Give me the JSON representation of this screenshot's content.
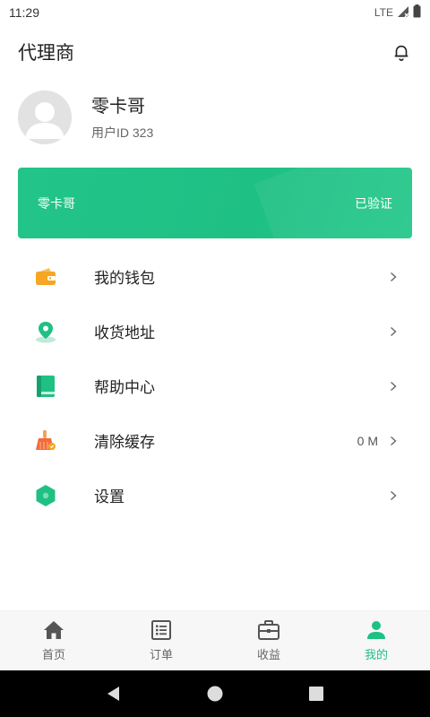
{
  "status_bar": {
    "time": "11:29",
    "network": "LTE"
  },
  "header": {
    "title": "代理商",
    "bell_icon": "bell-icon"
  },
  "profile": {
    "name": "零卡哥",
    "user_id": "用户ID 323",
    "avatar_icon": "user-avatar-placeholder"
  },
  "card": {
    "name": "零卡哥",
    "status": "已验证",
    "color": "#1fc084"
  },
  "menu": {
    "items": [
      {
        "label": "我的钱包",
        "icon": "wallet-icon",
        "value": ""
      },
      {
        "label": "收货地址",
        "icon": "location-pin-icon",
        "value": ""
      },
      {
        "label": "帮助中心",
        "icon": "book-icon",
        "value": ""
      },
      {
        "label": "清除缓存",
        "icon": "broom-icon",
        "value": "0 M"
      },
      {
        "label": "设置",
        "icon": "settings-hexagon-icon",
        "value": ""
      }
    ]
  },
  "bottom_nav": {
    "items": [
      {
        "label": "首页",
        "icon": "home-icon",
        "active": false
      },
      {
        "label": "订单",
        "icon": "list-icon",
        "active": false
      },
      {
        "label": "收益",
        "icon": "briefcase-icon",
        "active": false
      },
      {
        "label": "我的",
        "icon": "person-icon",
        "active": true
      }
    ]
  },
  "colors": {
    "accent": "#1fc084",
    "wallet": "#f5a623",
    "broom": "#f26b3a"
  }
}
